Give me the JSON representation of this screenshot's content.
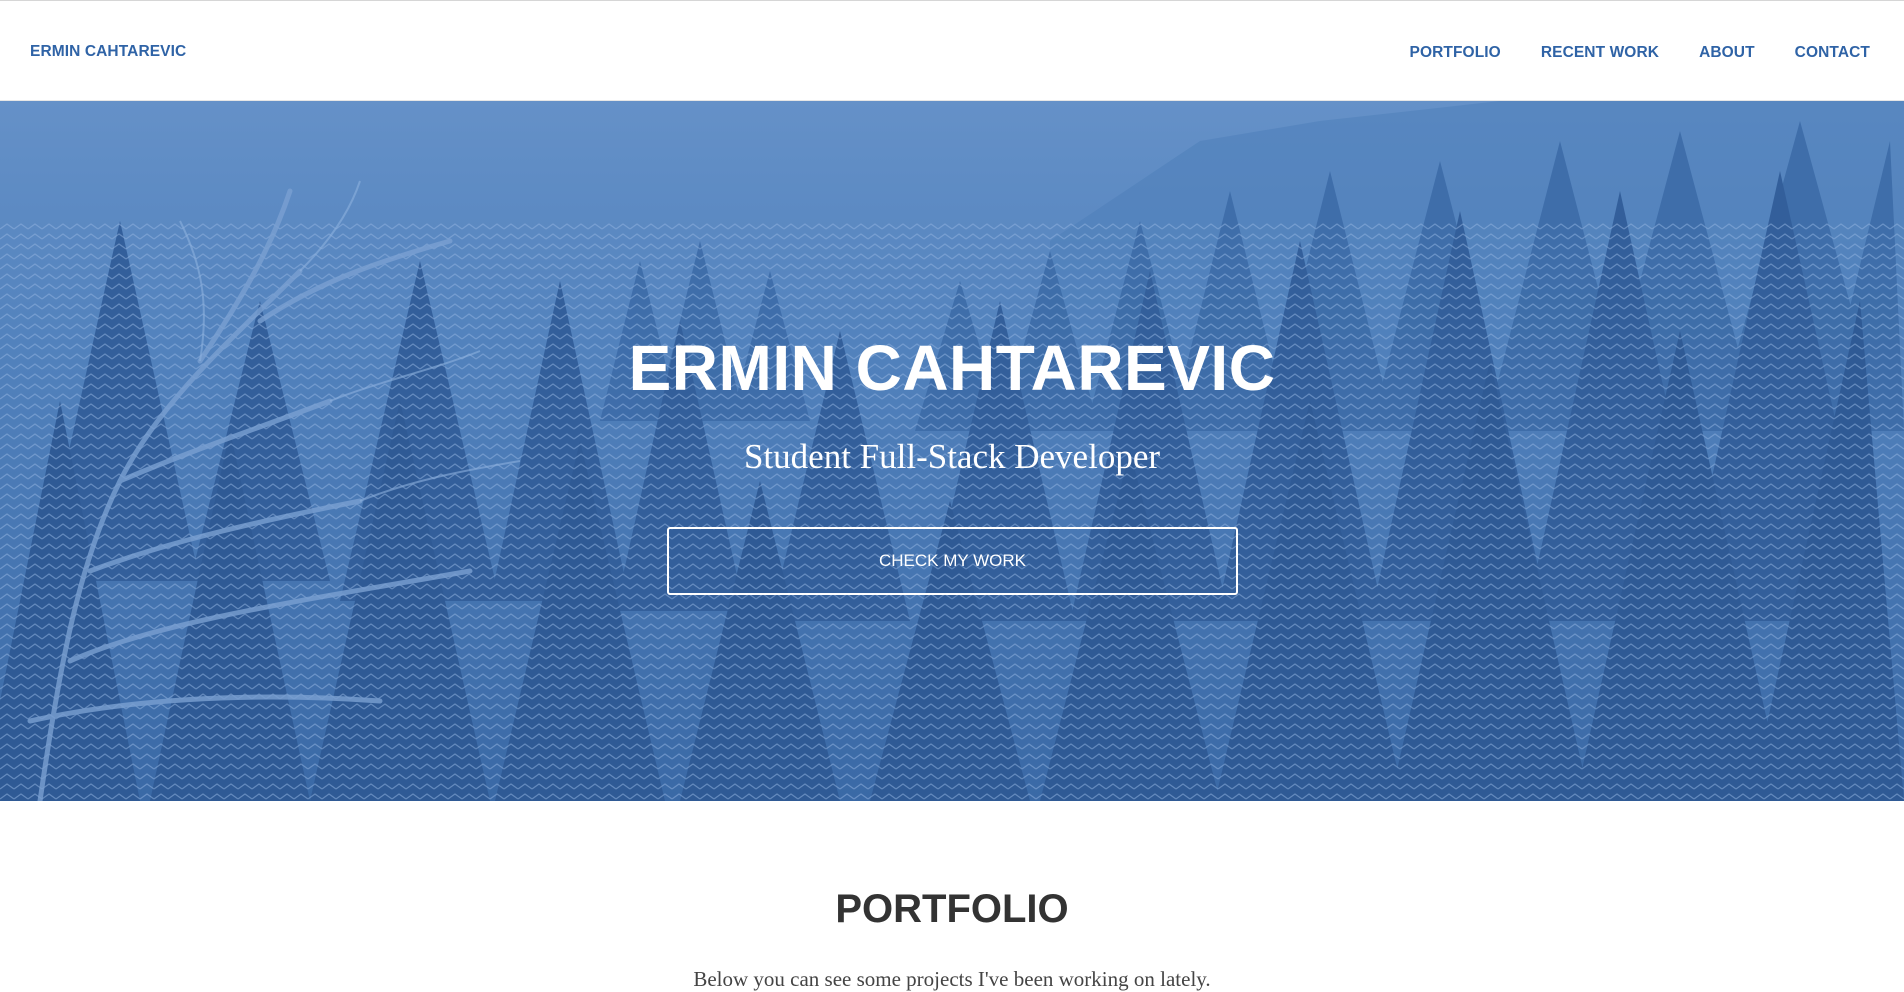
{
  "navbar": {
    "brand": "ERMIN CAHTAREVIC",
    "links": [
      {
        "label": "PORTFOLIO"
      },
      {
        "label": "RECENT WORK"
      },
      {
        "label": "ABOUT"
      },
      {
        "label": "CONTACT"
      }
    ]
  },
  "hero": {
    "title": "ERMIN CAHTAREVIC",
    "subtitle": "Student Full-Stack Developer",
    "button_label": "CHECK MY WORK"
  },
  "portfolio": {
    "title": "PORTFOLIO",
    "intro": "Below you can see some projects I've been working on lately."
  },
  "colors": {
    "accent": "#2f63a6",
    "hero_overlay": "#4a78b4",
    "heading": "#333333"
  }
}
